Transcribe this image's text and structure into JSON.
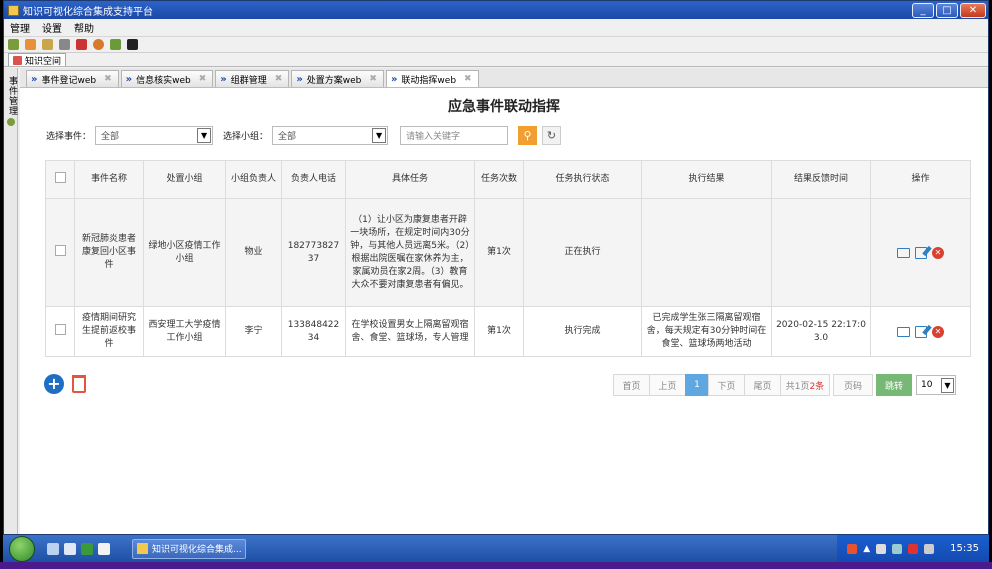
{
  "window": {
    "title": "知识可视化综合集成支持平台"
  },
  "menu": [
    "管理",
    "设置",
    "帮助"
  ],
  "space_tab": "知识空间",
  "side_label": "事件管理",
  "tabs": [
    {
      "label": "事件登记web"
    },
    {
      "label": "信息核实web"
    },
    {
      "label": "组群管理"
    },
    {
      "label": "处置方案web"
    },
    {
      "label": "联动指挥web"
    }
  ],
  "page": {
    "title": "应急事件联动指挥"
  },
  "filters": {
    "event_label": "选择事件：",
    "event_value": "全部",
    "group_label": "选择小组：",
    "group_value": "全部",
    "keyword_placeholder": "请输入关键字"
  },
  "table": {
    "headers": [
      "事件名称",
      "处置小组",
      "小组负责人",
      "负责人电话",
      "具体任务",
      "任务次数",
      "任务执行状态",
      "执行结果",
      "结果反馈时间",
      "操作"
    ],
    "rows": [
      {
        "event": "新冠肺炎患者康复回小区事件",
        "group": "绿地小区疫情工作小组",
        "leader": "物业",
        "phone": "18277382737",
        "task": "（1）让小区为康复患者开辟一块场所，在规定时间内30分钟，与其他人员远离5米。（2）根据出院医嘱在家休养为主，家属劝员在家2周。（3）教育大众不要对康复患者有偏见。",
        "count": "第1次",
        "status": "正在执行",
        "result": "",
        "time": ""
      },
      {
        "event": "疫情期间研究生提前返校事件",
        "group": "西安理工大学疫情工作小组",
        "leader": "李宁",
        "phone": "13384842234",
        "task": "在学校设置男女上隔离留观宿舍、食堂、篮球场，专人管理",
        "count": "第1次",
        "status": "执行完成",
        "result": "已完成学生张三隔离留观宿舍，每天规定有30分钟时间在食堂、篮球场两地活动",
        "time": "2020-02-15 22:17:03.0"
      }
    ]
  },
  "pager": {
    "first": "首页",
    "prev": "上页",
    "current": "1",
    "next": "下页",
    "last": "尾页",
    "total_prefix": "共1页",
    "total_count": "2条",
    "page_input": "页码",
    "jump": "跳转",
    "page_size": "10"
  },
  "taskbar": {
    "task_label": "知识可视化综合集成...",
    "clock": "15:35"
  }
}
